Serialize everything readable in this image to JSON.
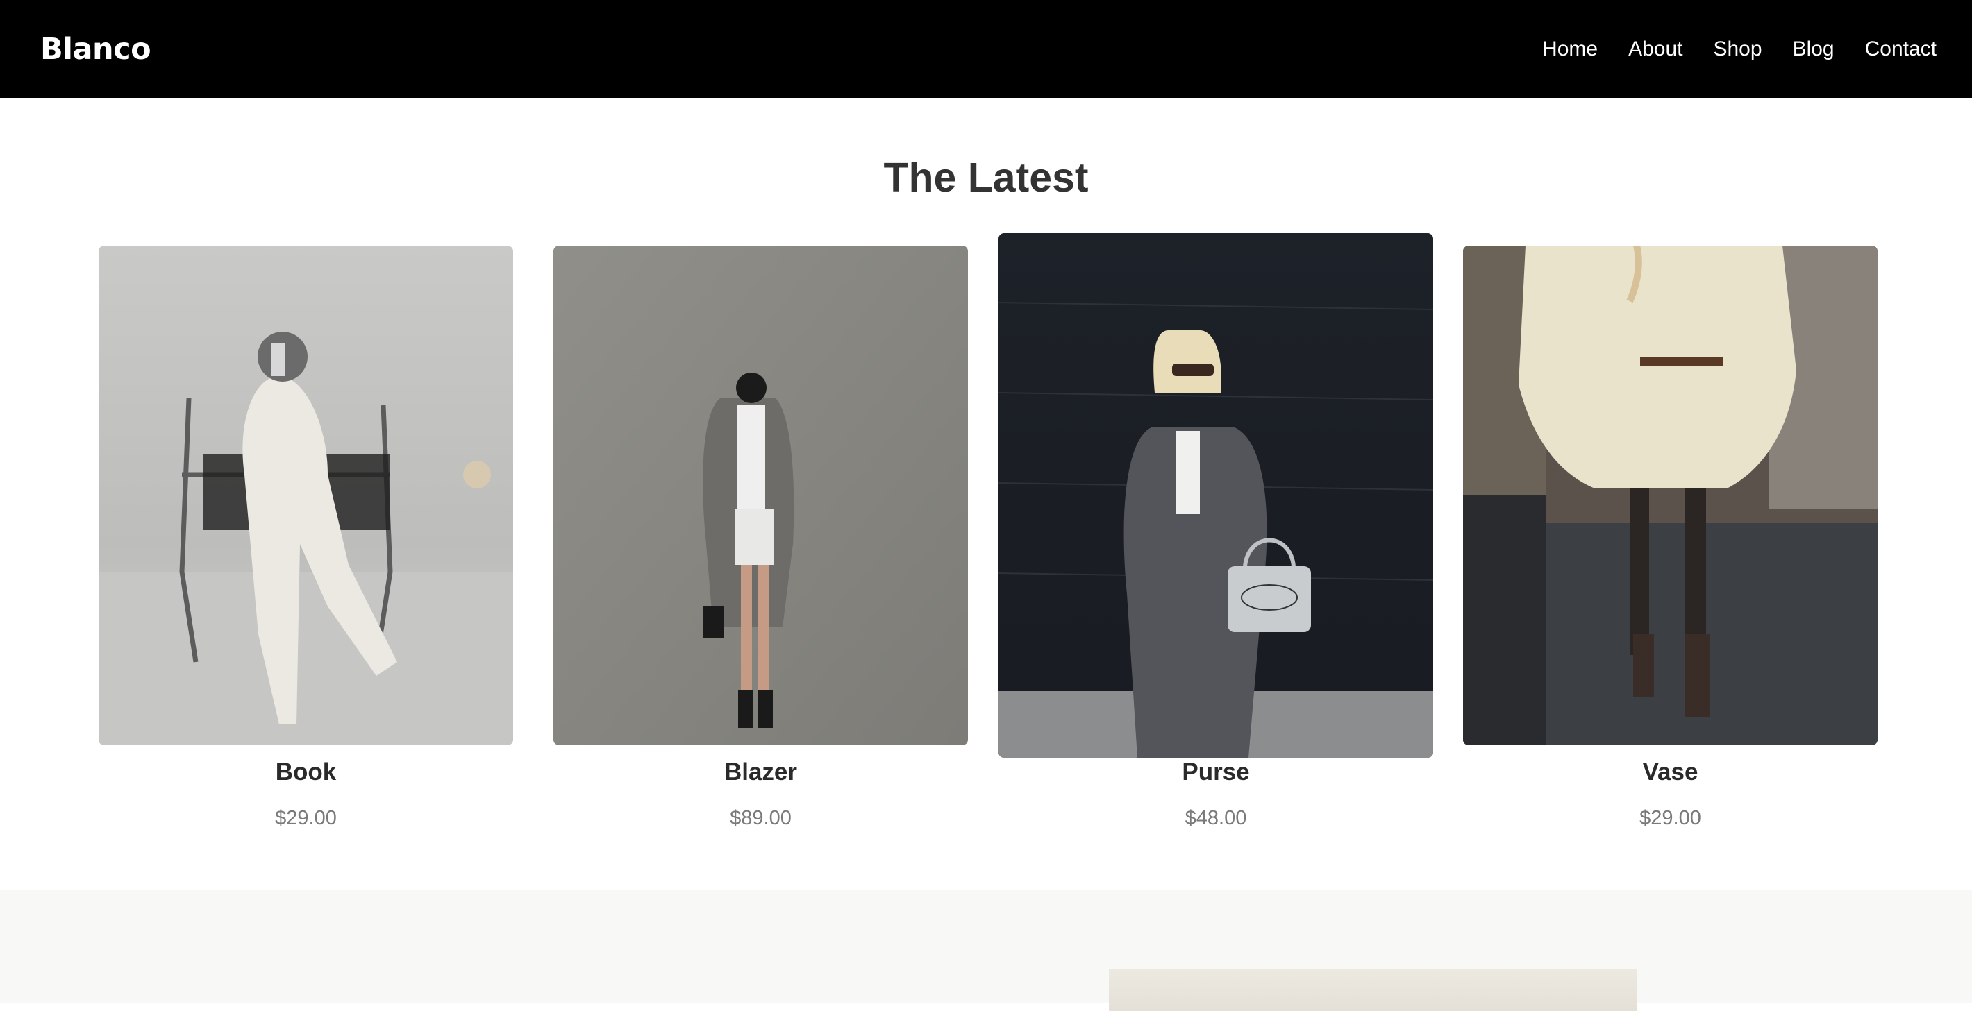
{
  "brand": {
    "name": "Blanco"
  },
  "nav": {
    "items": [
      "Home",
      "About",
      "Shop",
      "Blog",
      "Contact"
    ]
  },
  "latest": {
    "title": "The Latest",
    "products": [
      {
        "name": "Book",
        "price": "$29.00"
      },
      {
        "name": "Blazer",
        "price": "$89.00"
      },
      {
        "name": "Purse",
        "price": "$48.00"
      },
      {
        "name": "Vase",
        "price": "$29.00"
      }
    ]
  },
  "colors": {
    "header_bg": "#000000",
    "section_bg": "#f8f8f7",
    "price": "#7a7a7a"
  }
}
